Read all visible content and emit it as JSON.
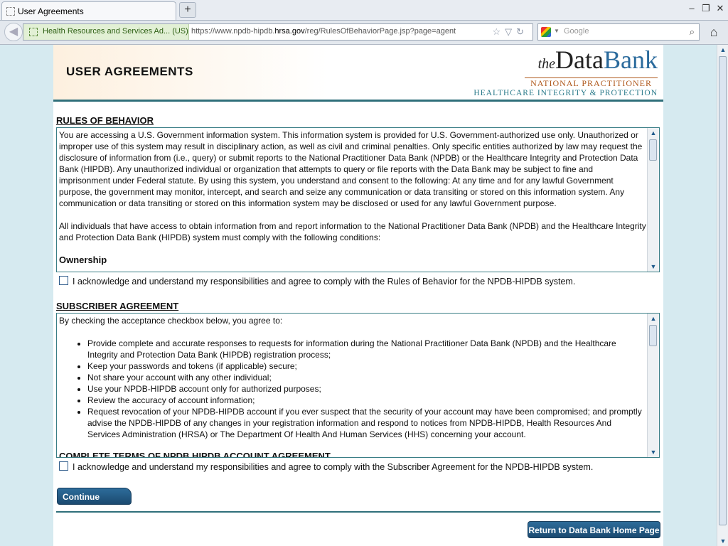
{
  "browser": {
    "tab_title": "User Agreements",
    "new_tab": "+",
    "identity": "Health Resources and Services Ad... (US)",
    "url_prefix": "https://www.npdb-hipdb.",
    "url_domain": "hrsa.gov",
    "url_suffix": "/reg/RulesOfBehaviorPage.jsp?page=agent",
    "search_placeholder": "Google",
    "window_controls": [
      "–",
      "❐",
      "✕"
    ]
  },
  "header": {
    "title": "USER AGREEMENTS",
    "logo_the": "the",
    "logo_data": "Data",
    "logo_bank": "Bank",
    "logo_line1": "NATIONAL PRACTITIONER",
    "logo_line2": "HEALTHCARE INTEGRITY & PROTECTION"
  },
  "rules": {
    "title": "RULES OF BEHAVIOR",
    "para1": "You are accessing a U.S. Government information system. This information system is provided for U.S. Government-authorized use only. Unauthorized or improper use of this system may result in disciplinary action, as well as civil and criminal penalties. Only specific entities authorized by law may request the disclosure of information from (i.e., query) or submit reports to the National Practitioner Data Bank (NPDB) or the Healthcare Integrity and Protection Data Bank (HIPDB). Any unauthorized individual or organization that attempts to query or file reports with the Data Bank may be subject to fine and imprisonment under Federal statute. By using this system, you understand and consent to the following: At any time and for any lawful Government purpose, the government may monitor, intercept, and search and seize any communication or data transiting or stored on this information system. Any communication or data transiting or stored on this information system may be disclosed or used for any lawful Government purpose.",
    "para2": "All individuals that have access to obtain information from and report information to the National Practitioner Data Bank (NPDB) and the Healthcare Integrity and Protection Data Bank (HIPDB) system must comply with the following conditions:",
    "subheading": "Ownership",
    "ack": "I acknowledge and understand my responsibilities and agree to comply with the Rules of Behavior for the NPDB-HIPDB system."
  },
  "subscriber": {
    "title": "SUBSCRIBER AGREEMENT",
    "intro": "By checking the acceptance checkbox below, you agree to:",
    "items": [
      "Provide complete and accurate responses to requests for information during the National Practitioner Data Bank (NPDB) and the Healthcare Integrity and Protection Data Bank (HIPDB) registration process;",
      "Keep your passwords and tokens (if applicable) secure;",
      "Not share your account with any other individual;",
      "Use your NPDB-HIPDB account only for authorized purposes;",
      "Review the accuracy of account information;",
      "Request revocation of your NPDB-HIPDB account if you ever suspect that the security of your account may have been compromised; and promptly advise the NPDB-HIPDB of any changes in your registration information and respond to notices from NPDB-HIPDB, Health Resources And Services Administration (HRSA) or The Department Of Health And Human Services (HHS) concerning your account."
    ],
    "subheading": "COMPLETE TERMS OF NPDB HIPDB ACCOUNT AGREEMENT",
    "ack": "I acknowledge and understand my responsibilities and agree to comply with the Subscriber Agreement for the NPDB-HIPDB system."
  },
  "actions": {
    "continue": "Continue",
    "return_home": "Return to Data Bank Home Page"
  }
}
